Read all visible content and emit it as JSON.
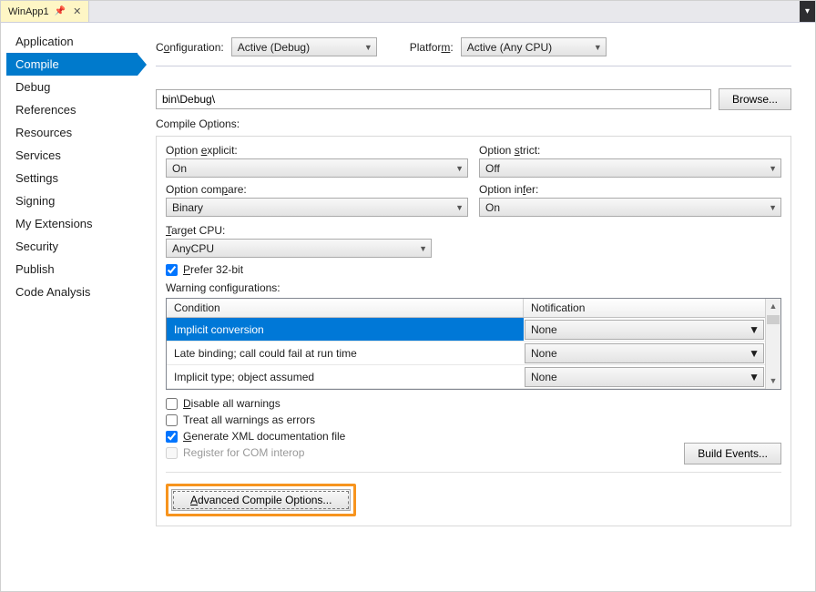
{
  "tab": {
    "title": "WinApp1"
  },
  "sidebar": {
    "items": [
      {
        "label": "Application"
      },
      {
        "label": "Compile"
      },
      {
        "label": "Debug"
      },
      {
        "label": "References"
      },
      {
        "label": "Resources"
      },
      {
        "label": "Services"
      },
      {
        "label": "Settings"
      },
      {
        "label": "Signing"
      },
      {
        "label": "My Extensions"
      },
      {
        "label": "Security"
      },
      {
        "label": "Publish"
      },
      {
        "label": "Code Analysis"
      }
    ],
    "selected": 1
  },
  "top": {
    "config_label_pre": "C",
    "config_label_u": "o",
    "config_label_post": "nfiguration:",
    "config_value": "Active (Debug)",
    "platform_label_pre": "Platfor",
    "platform_label_u": "m",
    "platform_label_post": ":",
    "platform_value": "Active (Any CPU)"
  },
  "path": {
    "value": "bin\\Debug\\",
    "browse": "Browse..."
  },
  "compile": {
    "title": "Compile Options:",
    "explicit_label": "Option explicit:",
    "explicit_u": "e",
    "explicit_val": "On",
    "strict_label": "Option strict:",
    "strict_u": "s",
    "strict_val": "Off",
    "compare_label": "Option compare:",
    "compare_u": "c",
    "compare_val": "Binary",
    "infer_label": "Option infer:",
    "infer_u": "i",
    "infer_val": "On",
    "target_label_pre": "",
    "target_u": "T",
    "target_label_post": "arget CPU:",
    "target_val": "AnyCPU",
    "prefer32": "Prefer 32-bit",
    "prefer32_u": "P",
    "warn_title": "Warning configurations:",
    "headers": {
      "c1": "Condition",
      "c2": "Notification"
    },
    "rows": [
      {
        "cond": "Implicit conversion",
        "notif": "None",
        "sel": true
      },
      {
        "cond": "Late binding; call could fail at run time",
        "notif": "None"
      },
      {
        "cond": "Implicit type; object assumed",
        "notif": "None"
      }
    ],
    "disable_all": "Disable all warnings",
    "disable_u": "D",
    "treat_errors": "Treat all warnings as errors",
    "gen_xml": "Generate XML documentation file",
    "gen_u": "G",
    "reg_com": "Register for COM interop",
    "build_events": "Build Events...",
    "advanced": "Advanced Compile Options...",
    "advanced_u": "A"
  }
}
